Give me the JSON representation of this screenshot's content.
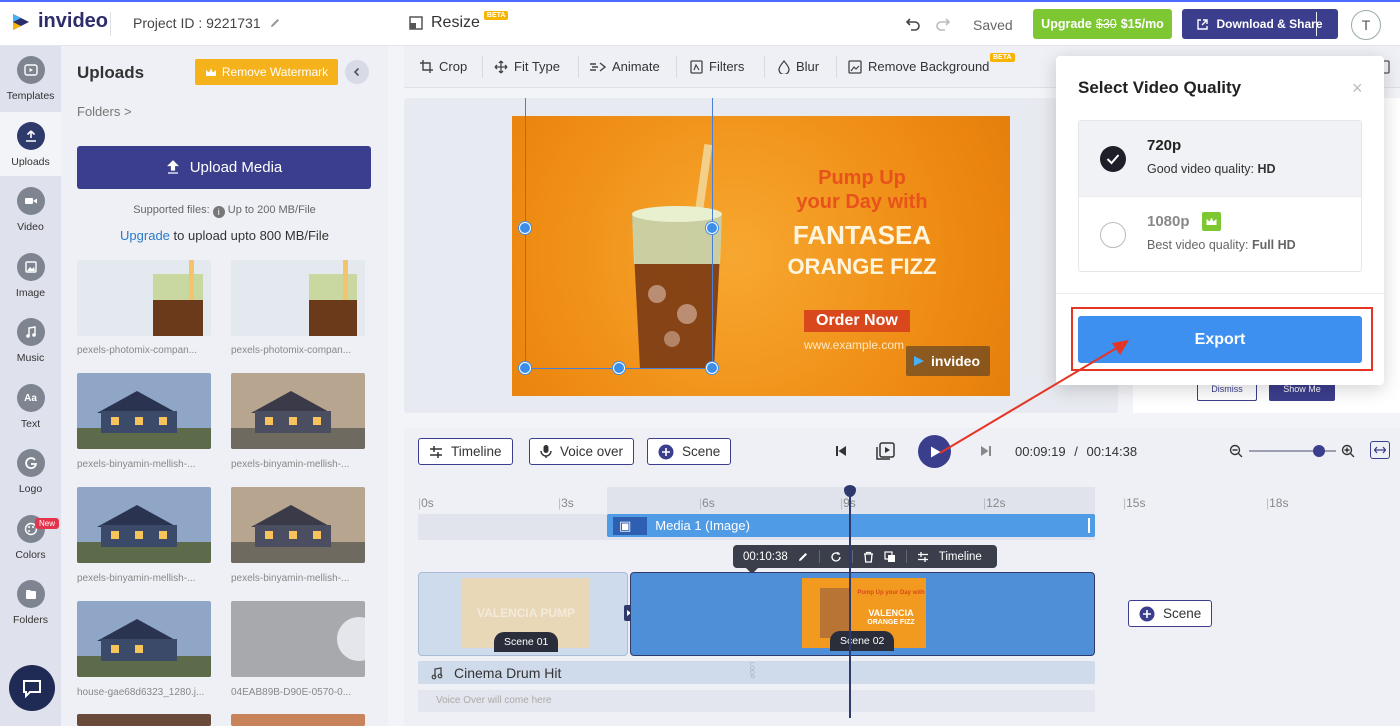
{
  "app": {
    "logo_text": "invideo"
  },
  "topbar": {
    "project_id": "Project ID : 9221731",
    "resize_label": "Resize",
    "resize_badge": "BETA",
    "saved_label": "Saved",
    "upgrade_label": "Upgrade",
    "upgrade_old_price": "$30",
    "upgrade_new_price": "$15/mo",
    "download_label": "Download & Share",
    "avatar_initial": "T"
  },
  "rail": {
    "items": [
      {
        "label": "Templates",
        "icon": "play-icon"
      },
      {
        "label": "Uploads",
        "icon": "upload-icon"
      },
      {
        "label": "Video",
        "icon": "video-camera-icon"
      },
      {
        "label": "Image",
        "icon": "image-icon"
      },
      {
        "label": "Music",
        "icon": "music-note-icon"
      },
      {
        "label": "Text",
        "icon": "text-aa-icon"
      },
      {
        "label": "Logo",
        "icon": "logo-icon"
      },
      {
        "label": "Colors",
        "icon": "palette-icon"
      },
      {
        "label": "Folders",
        "icon": "folder-icon"
      }
    ],
    "new_badge": "New"
  },
  "uploads": {
    "title": "Uploads",
    "remove_watermark": "Remove Watermark",
    "folders_link": "Folders >",
    "upload_button": "Upload Media",
    "supported_prefix": "Supported files:",
    "supported_suffix": "Up to 200 MB/File",
    "upgrade_link": "Upgrade",
    "upgrade_text": "to upload upto 800 MB/File",
    "files": [
      {
        "name": "pexels-photomix-compan..."
      },
      {
        "name": "pexels-photomix-compan..."
      },
      {
        "name": "pexels-binyamin-mellish-..."
      },
      {
        "name": "pexels-binyamin-mellish-..."
      },
      {
        "name": "pexels-binyamin-mellish-..."
      },
      {
        "name": "pexels-binyamin-mellish-..."
      },
      {
        "name": "house-gae68d6323_1280.j..."
      },
      {
        "name": "04EAB89B-D90E-0570-0..."
      }
    ]
  },
  "toolbar": {
    "crop": "Crop",
    "fit_type": "Fit Type",
    "animate": "Animate",
    "filters": "Filters",
    "blur": "Blur",
    "remove_background": "Remove Background",
    "remove_background_badge": "BETA"
  },
  "canvas": {
    "ad_line1": "Pump Up",
    "ad_line2": "your Day with",
    "ad_line3": "FANTASEA",
    "ad_line4": "ORANGE FIZZ",
    "ad_cta": "Order Now",
    "ad_url": "www.example.com",
    "ad_watermark": "invideo"
  },
  "timeline": {
    "timeline_btn": "Timeline",
    "voice_over_btn": "Voice over",
    "scene_btn": "Scene",
    "current_time": "00:09:19",
    "separator": "/",
    "total_time": "00:14:38",
    "zoom_level": 0.8,
    "ruler": [
      "0s",
      "3s",
      "6s",
      "9s",
      "12s",
      "15s",
      "18s"
    ],
    "media_track": "Media 1 (Image)",
    "popup_time": "00:10:38",
    "popup_timeline": "Timeline",
    "scene1_label": "Scene 01",
    "scene1_text": "VALENCIA PUMP",
    "scene2_label": "Scene 02",
    "scene2_text1": "Pump Up your Day with",
    "scene2_text2": "VALENCIA",
    "scene2_text3": "ORANGE FIZZ",
    "add_scene": "Scene",
    "audio_track": "Cinema Drum Hit",
    "audio_loop": "LOOP",
    "voiceover_placeholder": "Voice Over will come here"
  },
  "behind_modal": {
    "dismiss": "Dismiss",
    "show_me": "Show Me"
  },
  "modal": {
    "title": "Select Video Quality",
    "options": [
      {
        "name": "720p",
        "desc_prefix": "Good video quality:",
        "desc_bold": "HD",
        "selected": true,
        "premium": false
      },
      {
        "name": "1080p",
        "desc_prefix": "Best video quality:",
        "desc_bold": "Full HD",
        "selected": false,
        "premium": true
      }
    ],
    "export_button": "Export"
  },
  "colors": {
    "brand_dark": "#3b3e8c",
    "upgrade_green": "#7dc832",
    "export_blue": "#3d8ff0",
    "annotation_red": "#e53525",
    "watermark_yellow": "#f5b21b"
  }
}
